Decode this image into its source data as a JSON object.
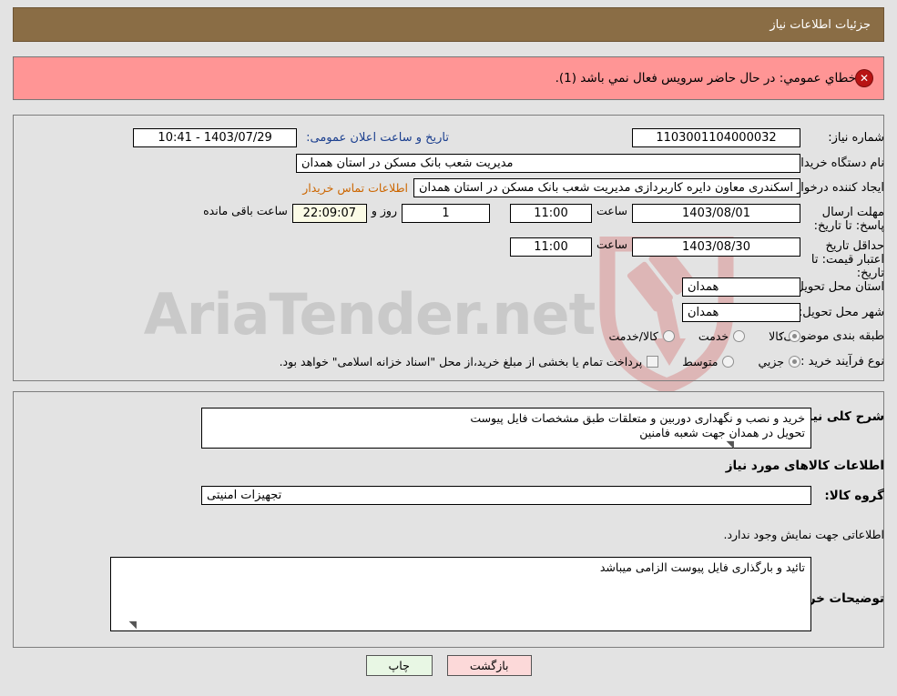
{
  "header": {
    "title": "جزئیات اطلاعات نیاز"
  },
  "error": {
    "icon": "error-circle-icon",
    "message": "خطاي عمومي: در حال حاضر سرویس فعال نمي باشد (1)."
  },
  "main_form": {
    "need_number": {
      "label": "شماره نیاز:",
      "value": "1103001104000032"
    },
    "announce_datetime": {
      "label": "تاریخ و ساعت اعلان عمومی:",
      "value": "1403/07/29 - 10:41"
    },
    "buyer_org": {
      "label": "نام دستگاه خریدار:",
      "value": "مدیریت شعب بانک مسکن در استان همدان"
    },
    "request_creator": {
      "label": "ایجاد کننده درخواست:",
      "value": "امیر اسکندری معاون دایره کاربردازی مدیریت شعب بانک مسکن در استان همدان",
      "link_label": "اطلاعات تماس خریدار"
    },
    "response_deadline": {
      "label": "مهلت ارسال پاسخ: تا تاریخ:",
      "date": "1403/08/01",
      "time_label": "ساعت",
      "time": "11:00",
      "days_remaining": "1",
      "days_label": "روز و",
      "countdown": "22:09:07",
      "countdown_suffix": "ساعت باقی مانده"
    },
    "price_validity": {
      "label": "حداقل تاریخ اعتبار قیمت: تا تاریخ:",
      "date": "1403/08/30",
      "time_label": "ساعت",
      "time": "11:00"
    },
    "delivery_province": {
      "label": "استان محل تحویل:",
      "value": "همدان"
    },
    "delivery_city": {
      "label": "شهر محل تحویل:",
      "value": "همدان"
    },
    "category": {
      "label": "طبقه بندی موضوعی:",
      "options": [
        {
          "label": "کالا",
          "selected": true
        },
        {
          "label": "خدمت",
          "selected": false
        },
        {
          "label": "کالا/خدمت",
          "selected": false
        }
      ]
    },
    "purchase_process": {
      "label": "نوع فرآیند خرید :",
      "options": [
        {
          "label": "جزیي",
          "selected": true
        },
        {
          "label": "متوسط",
          "selected": false
        }
      ],
      "checkbox": {
        "label": "پرداخت تمام یا بخشی از مبلغ خرید،از محل \"اسناد خزانه اسلامی\" خواهد بود.",
        "checked": false
      }
    }
  },
  "description_section": {
    "summary": {
      "label": "شرح کلی نیاز:",
      "value": "خرید و نصب و نگهداری دوربین و متعلقات طبق مشخصات فایل پیوست\nتحویل در همدان جهت شعبه فامنین"
    },
    "goods_heading": "اطلاعات کالاهای مورد نیاز",
    "goods_group": {
      "label": "گروه کالا:",
      "value": "تجهیزات امنیتی"
    },
    "empty_note": "اطلاعاتی جهت نمایش وجود ندارد.",
    "buyer_comments": {
      "label": "توضیحات خریدار:",
      "value": "تائید و بارگذاری فایل پیوست الزامی میباشد"
    }
  },
  "footer": {
    "print_label": "چاپ",
    "back_label": "بازگشت"
  },
  "watermark": {
    "text": "AriaTender.net",
    "logo": "shield-gavel-logo"
  },
  "colors": {
    "header_bg": "#8a6d45",
    "error_bg": "#ff9595",
    "page_bg": "#e3e3e3",
    "link": "#cc6600",
    "label_blue": "#1b3f8f",
    "print_btn": "#e8f7e4",
    "back_btn": "#fcd9d9"
  }
}
